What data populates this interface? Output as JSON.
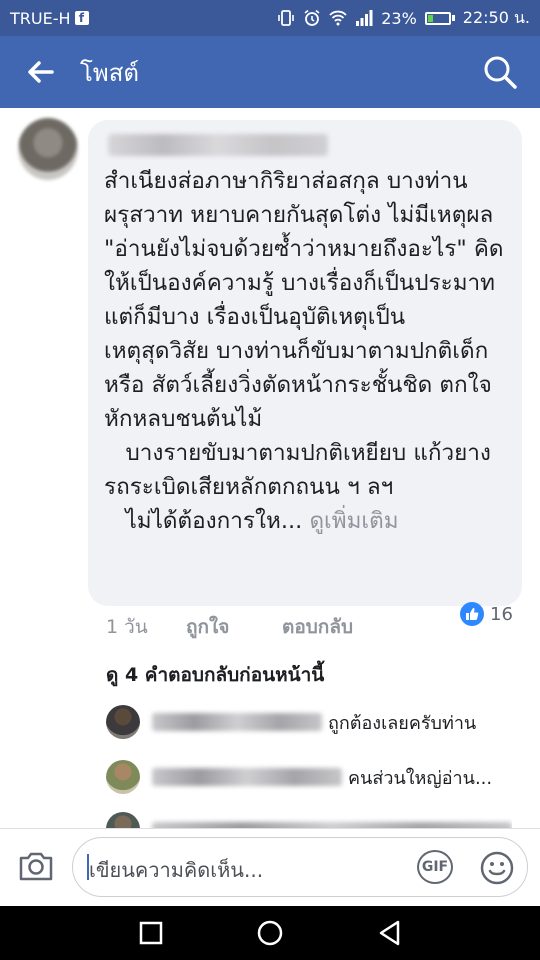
{
  "status_bar": {
    "carrier": "TRUE-H",
    "battery_percent": "23%",
    "battery_level": 0.23,
    "time": "22:50 น."
  },
  "header": {
    "title": "โพสต์",
    "bg_color": "#4267b2"
  },
  "comment": {
    "text": "สำเนียงส่อภาษากิริยาส่อสกุล บางท่านผรุสวาท หยาบคายกันสุดโต่ง ไม่มีเหตุผล \"อ่านยังไม่จบด้วยซ้ำว่าหมายถึงอะไร\" คิดให้เป็นองค์ความรู้ บางเรื่องก็เป็นประมาท แต่ก็มีบาง เรื่องเป็นอุบัติเหตุเป็นเหตุสุดวิสัย บางท่านก็ขับมาตามปกติเด็กหรือ สัตว์เลี้ยงวิ่งตัดหน้ากระชั้นชิด ตกใจ หักหลบชนต้นไม้\n   บางรายขับมาตามปกติเหยียบ แก้วยางรถระเบิดเสียหลักตกถนน ฯ ลฯ\n   ไม่ได้ต้องการให...",
    "see_more": "ดูเพิ่มเติม",
    "time": "1 วัน",
    "like_label": "ถูกใจ",
    "reply_label": "ตอบกลับ",
    "reaction_count": "16",
    "reaction_icon": "like-thumb-icon"
  },
  "view_previous_replies": "ดู 4 คำตอบกลับก่อนหน้านี้",
  "replies": [
    {
      "text": "ถูกต้องเลยครับท่าน"
    },
    {
      "text": "คนส่วนใหญ่อ่าน..."
    }
  ],
  "composer": {
    "placeholder": "เขียนความคิดเห็น...",
    "gif_label": "GIF"
  }
}
